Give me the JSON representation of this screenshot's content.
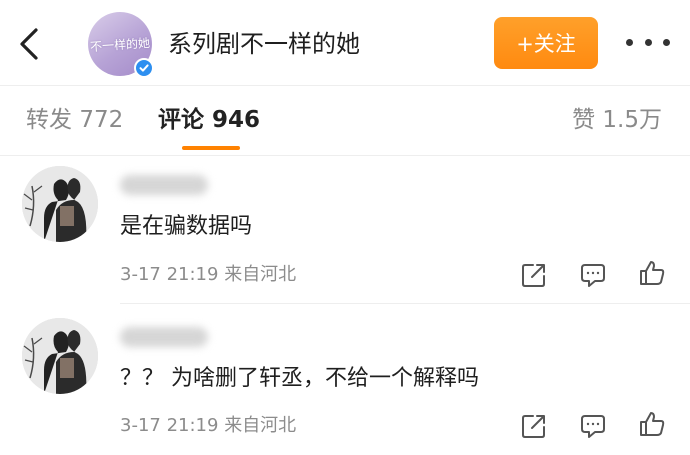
{
  "header": {
    "title": "系列剧不一样的她",
    "avatar_text": "不一样的她",
    "follow_label": "+关注",
    "colors": {
      "accent": "#ff8a10",
      "verified": "#2d8ff0"
    }
  },
  "tabs": [
    {
      "label": "转发",
      "count": "772",
      "active": false
    },
    {
      "label": "评论",
      "count": "946",
      "active": true
    },
    {
      "label": "赞",
      "count": "1.5万",
      "active": false
    }
  ],
  "comments": [
    {
      "text": "是在骗数据吗",
      "time": "3-17 21:19",
      "source": "来自河北"
    },
    {
      "text": "？？ 为啥删了轩丞，不给一个解释吗",
      "time": "3-17 21:19",
      "source": "来自河北"
    }
  ],
  "icons": [
    "back-arrow-icon",
    "verified-icon",
    "more-dots-icon",
    "share-icon",
    "comment-icon",
    "like-icon"
  ]
}
